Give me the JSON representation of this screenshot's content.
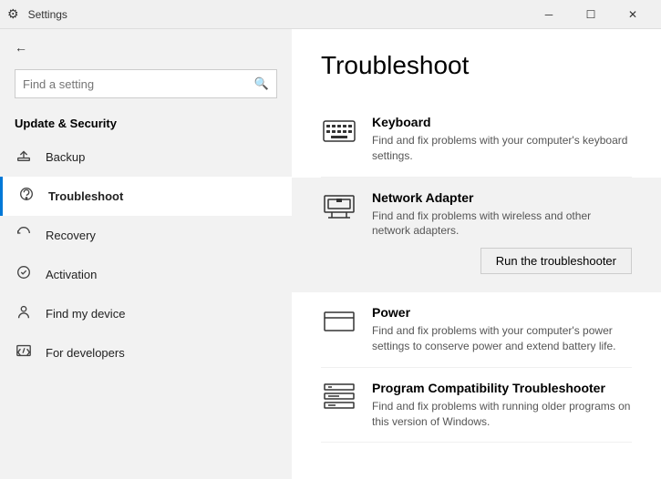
{
  "titleBar": {
    "title": "Settings",
    "minimizeLabel": "─",
    "maximizeLabel": "☐",
    "closeLabel": "✕"
  },
  "sidebar": {
    "searchPlaceholder": "Find a setting",
    "sectionTitle": "Update & Security",
    "items": [
      {
        "id": "backup",
        "label": "Backup",
        "icon": "↑"
      },
      {
        "id": "troubleshoot",
        "label": "Troubleshoot",
        "icon": "🔑",
        "active": true
      },
      {
        "id": "recovery",
        "label": "Recovery",
        "icon": "↺"
      },
      {
        "id": "activation",
        "label": "Activation",
        "icon": "✓"
      },
      {
        "id": "find-my-device",
        "label": "Find my device",
        "icon": "👤"
      },
      {
        "id": "for-developers",
        "label": "For developers",
        "icon": "⚙"
      }
    ]
  },
  "content": {
    "title": "Troubleshoot",
    "items": [
      {
        "id": "keyboard",
        "title": "Keyboard",
        "description": "Find and fix problems with your computer's keyboard settings.",
        "highlighted": false
      },
      {
        "id": "network-adapter",
        "title": "Network Adapter",
        "description": "Find and fix problems with wireless and other network adapters.",
        "highlighted": true
      },
      {
        "id": "power",
        "title": "Power",
        "description": "Find and fix problems with your computer's power settings to conserve power and extend battery life.",
        "highlighted": false
      },
      {
        "id": "program-compatibility",
        "title": "Program Compatibility Troubleshooter",
        "description": "Find and fix problems with running older programs on this version of Windows.",
        "highlighted": false
      }
    ],
    "runButtonLabel": "Run the troubleshooter"
  }
}
